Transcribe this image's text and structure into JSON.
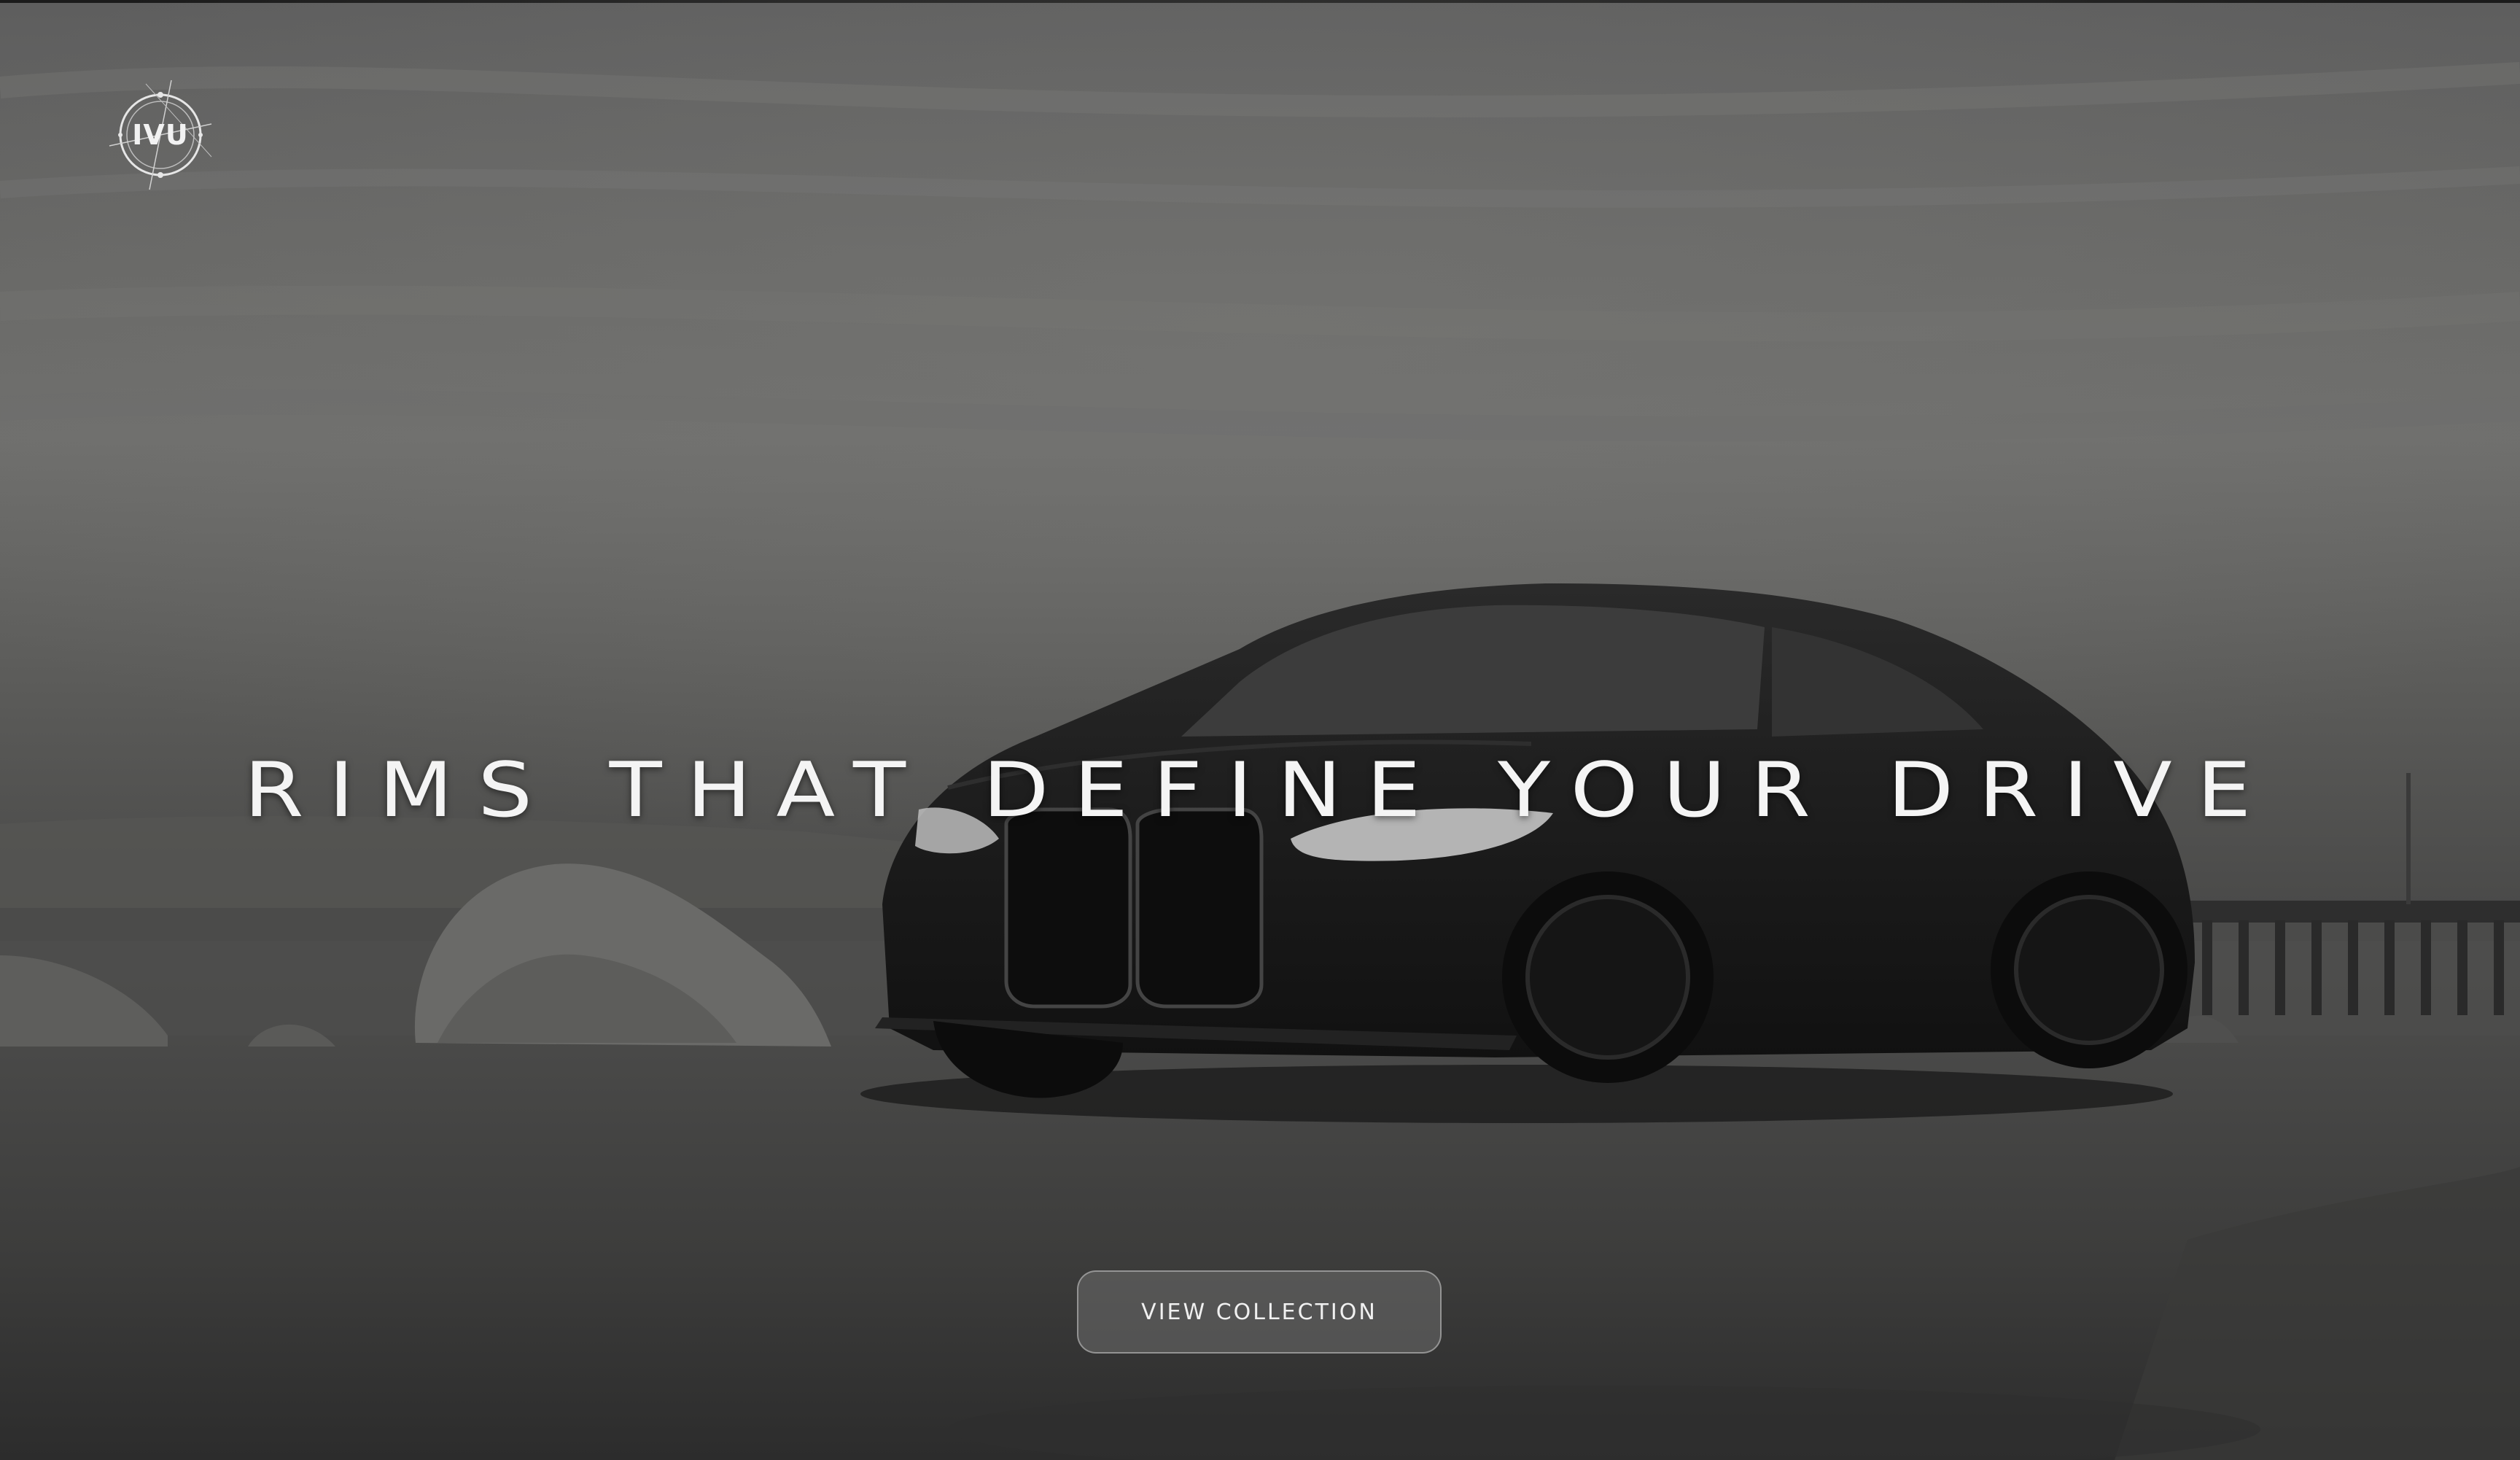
{
  "brand": {
    "logo_text": "IVU"
  },
  "hero": {
    "headline": "RIMS THAT DEFINE YOUR DRIVE",
    "cta_label": "VIEW COLLECTION"
  },
  "colors": {
    "text": "#f4f4f4",
    "button_bg": "#787878",
    "button_border": "#c8c8c8"
  },
  "icons": [
    "ivu-logo-icon"
  ]
}
